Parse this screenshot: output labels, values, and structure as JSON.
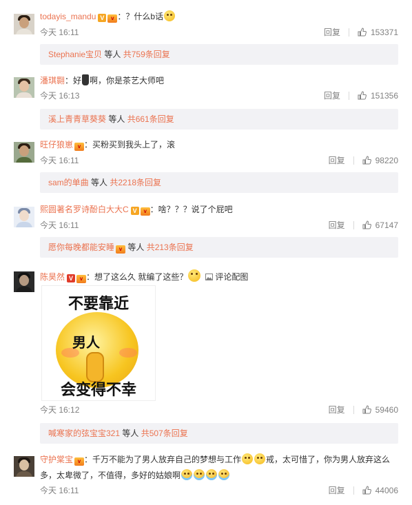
{
  "comments": [
    {
      "username": "todayis_mandu",
      "text": "：？什么b话",
      "time": "今天 16:11",
      "reply_label": "回复",
      "likes": "153371",
      "reply_summary": {
        "name": "Stephanie宝贝",
        "etc": " 等人 ",
        "total": "共759条回复"
      }
    },
    {
      "username": "潘琪翾",
      "text_a": "：好",
      "text_b": "啊，你是茶艺大师吧",
      "time": "今天 16:13",
      "reply_label": "回复",
      "likes": "151356",
      "reply_summary": {
        "name": "溪上青青草葵葵",
        "etc": " 等人 ",
        "total": "共661条回复"
      }
    },
    {
      "username": "旺仔狼崽",
      "text": "：买粉买到我头上了，滚",
      "time": "今天 16:11",
      "reply_label": "回复",
      "likes": "98220",
      "reply_summary": {
        "name": "sam的单曲",
        "etc": " 等人 ",
        "total": "共2218条回复"
      }
    },
    {
      "username": "熙圆著名罗诗酚白大大C",
      "text": "：啥？？？说了个屁吧",
      "time": "今天 16:11",
      "reply_label": "回复",
      "likes": "67147",
      "reply_summary": {
        "name": "愿你每晚都能安睡",
        "etc": " 等人 ",
        "total": "共213条回复"
      }
    },
    {
      "username": "陈昊然",
      "text": "：想了这么久 就编了这些？",
      "pic_link": "评论配图",
      "sticker_top": "不要靠近",
      "sticker_mid": "男人",
      "sticker_bottom": "会变得不幸",
      "time": "今天 16:12",
      "reply_label": "回复",
      "likes": "59460",
      "reply_summary": {
        "name": "喊寒家的弦宝宝321",
        "etc": " 等人 ",
        "total": "共507条回复"
      }
    },
    {
      "username": "守护棠宝",
      "text_a": "：千万不能为了男人放弃自己的梦想与工作",
      "text_b": "戒，太可惜了，你为男人放弃这么",
      "text_c": "多，太卑微了，不值得，多好的姑娘啊",
      "time": "今天 16:11",
      "reply_label": "回复",
      "likes": "44006"
    }
  ],
  "icons": {
    "thumb": "thumbs-up-icon",
    "verified": "verified-v-icon",
    "vip": "vip-badge-icon",
    "picture": "picture-icon"
  },
  "colors": {
    "username": "#eb7350",
    "muted": "#808080",
    "reply_bg": "#f2f2f5"
  }
}
